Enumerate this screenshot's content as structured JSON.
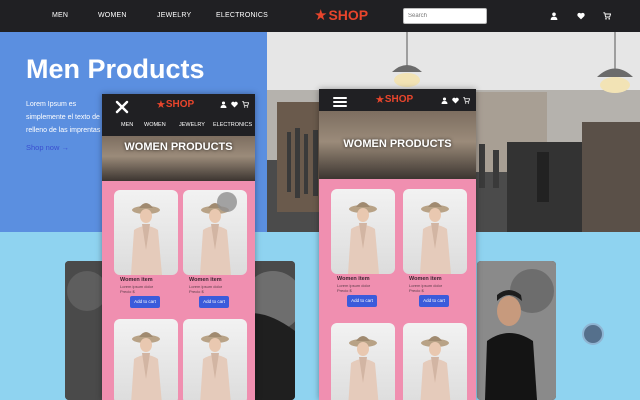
{
  "header": {
    "nav": [
      "MEN",
      "WOMEN",
      "JEWELRY",
      "ELECTRONICS"
    ],
    "logo": "SHOP",
    "search_placeholder": "Search",
    "icons": [
      "user-icon",
      "heart-icon",
      "cart-icon"
    ]
  },
  "hero": {
    "title": "Men Products",
    "text": "Lorem Ipsum es simplemente el texto de relleno de las imprentas y archivos de texto. Lorem Ipsum ha sido el texto de relleno estándar de las industrias",
    "link": "Shop now →"
  },
  "phone_left": {
    "logo": "SHOP",
    "nav": [
      "MEN",
      "WOMEN",
      "JEWELRY",
      "ELECTRONICS"
    ],
    "banner": "WOMEN PRODUCTS",
    "card": {
      "title": "Women item",
      "desc": "Lorem ipsum dolor",
      "price": "Precio $",
      "button": "Add to cart"
    }
  },
  "phone_right": {
    "logo": "SHOP",
    "banner": "WOMEN PRODUCTS",
    "card": {
      "title": "Women item",
      "desc": "Lorem ipsum dolor",
      "price": "Precio $",
      "button": "Add to cart"
    }
  },
  "colors": {
    "nav_bg": "#202023",
    "logo": "#e8452c",
    "hero_blue": "#5b8fe0",
    "phone_pink": "#f08fb0",
    "button_blue": "#3b5bdb",
    "page_bg": "#8fd3f0"
  }
}
